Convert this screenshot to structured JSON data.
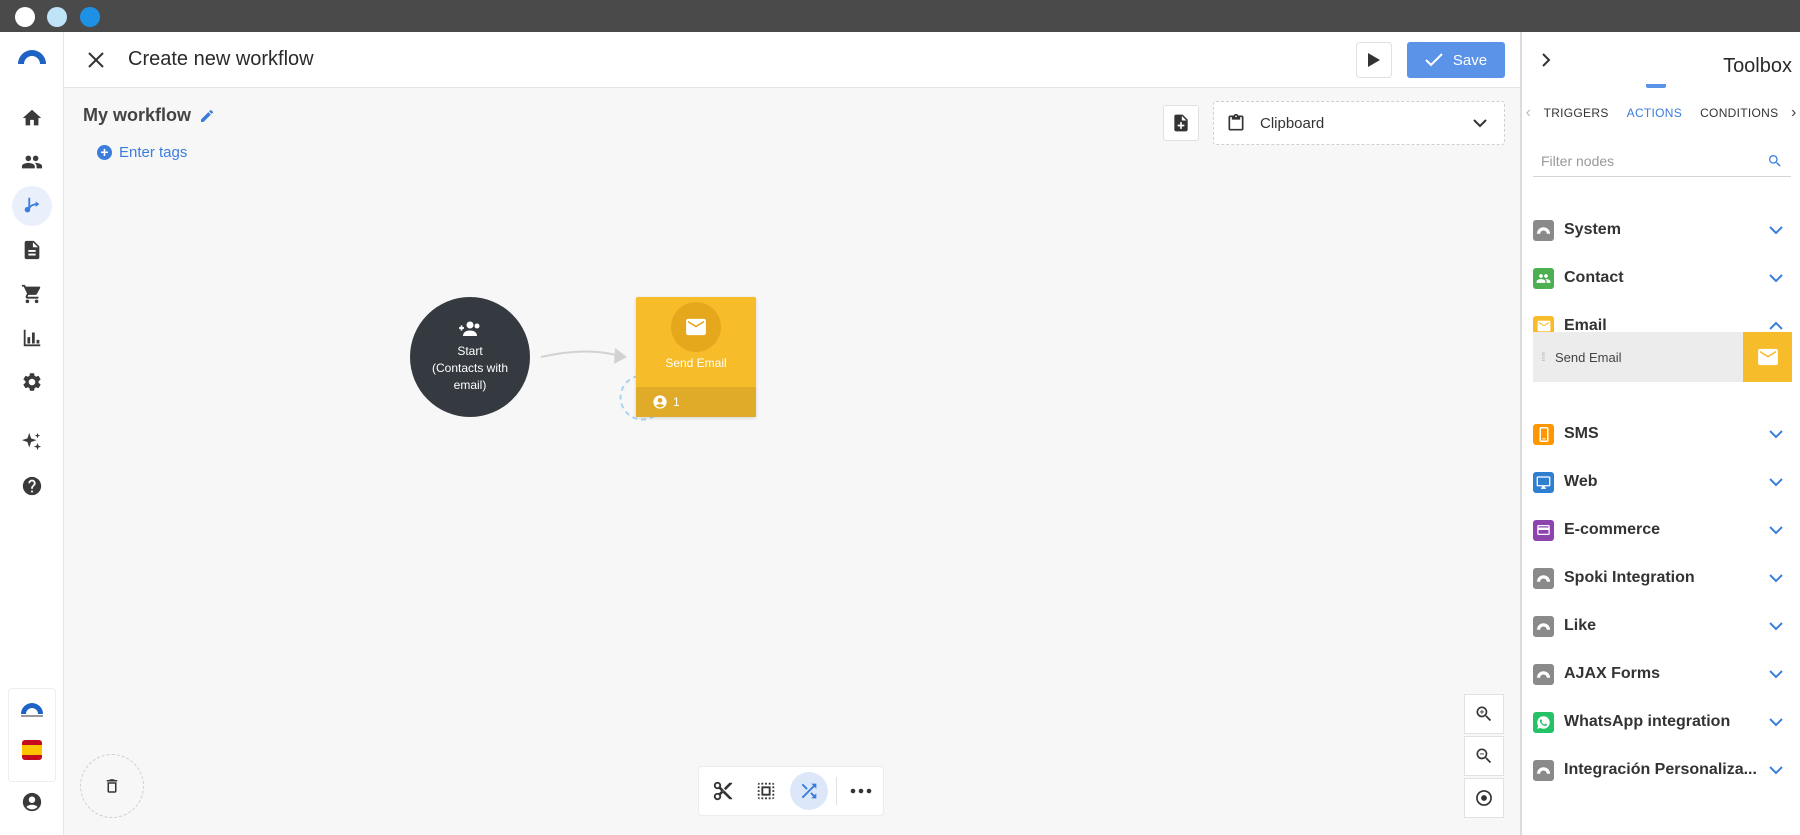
{
  "window": {
    "dots": [
      "#ffffff",
      "#bfe3f7",
      "#1e90e6"
    ]
  },
  "header": {
    "title": "Create new workflow",
    "save_label": "Save"
  },
  "canvas": {
    "workflow_name": "My workflow",
    "tags_label": "Enter tags",
    "clipboard_label": "Clipboard",
    "start_node": {
      "line1": "Start",
      "line2": "(Contacts with",
      "line3": "email)"
    },
    "email_node": {
      "label": "Send Email",
      "count": "1",
      "color": "#f7bc2a"
    }
  },
  "sidebar": {
    "items": [
      "home-icon",
      "people-icon",
      "workflow-icon",
      "document-icon",
      "cart-icon",
      "chart-icon",
      "settings-icon",
      "sparkle-icon",
      "help-icon"
    ],
    "active": "workflow-icon"
  },
  "toolbox": {
    "title": "Toolbox",
    "tabs": [
      {
        "label": "TRIGGERS",
        "active": false
      },
      {
        "label": "ACTIONS",
        "active": true
      },
      {
        "label": "CONDITIONS",
        "active": false
      }
    ],
    "filter_placeholder": "Filter nodes",
    "categories": [
      {
        "label": "System",
        "color": "#8a8a8a",
        "expanded": false
      },
      {
        "label": "Contact",
        "color": "#4caf50",
        "expanded": false
      },
      {
        "label": "Email",
        "color": "#f7bc2a",
        "expanded": true
      },
      {
        "label": "SMS",
        "color": "#ff9800",
        "expanded": false
      },
      {
        "label": "Web",
        "color": "#2f7fd1",
        "expanded": false
      },
      {
        "label": "E-commerce",
        "color": "#8e44ad",
        "expanded": false
      },
      {
        "label": "Spoki Integration",
        "color": "#8a8a8a",
        "expanded": false
      },
      {
        "label": "Like",
        "color": "#8a8a8a",
        "expanded": false
      },
      {
        "label": "AJAX Forms",
        "color": "#8a8a8a",
        "expanded": false
      },
      {
        "label": "WhatsApp integration",
        "color": "#25c268",
        "expanded": false
      },
      {
        "label": "Integración Personaliza...",
        "color": "#8a8a8a",
        "expanded": false
      }
    ],
    "email_items": [
      {
        "label": "Send Email"
      }
    ]
  },
  "colors": {
    "accent": "#3b7ddd",
    "save": "#5b93e8",
    "dark_node": "#343a40"
  }
}
